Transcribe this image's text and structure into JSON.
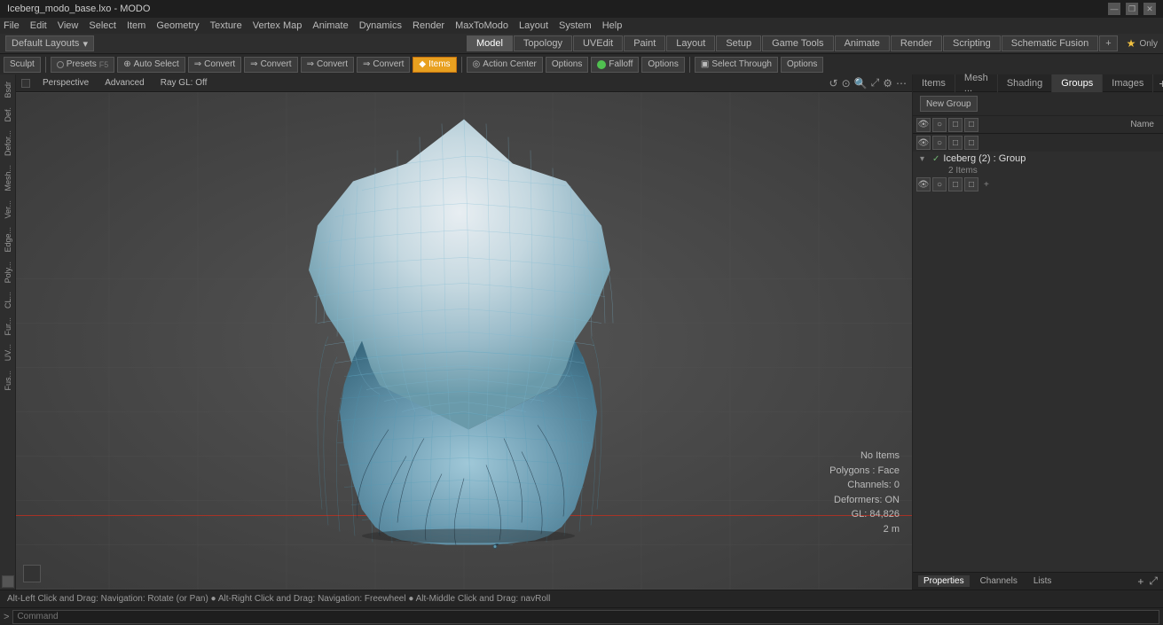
{
  "titleBar": {
    "title": "Iceberg_modo_base.lxo - MODO",
    "minimize": "—",
    "restore": "❐",
    "close": "✕"
  },
  "menuBar": {
    "items": [
      "File",
      "Edit",
      "View",
      "Select",
      "Item",
      "Geometry",
      "Texture",
      "Vertex Map",
      "Animate",
      "Dynamics",
      "Render",
      "MaxToModo",
      "Layout",
      "System",
      "Help"
    ]
  },
  "layoutsBar": {
    "dropdown": "Default Layouts",
    "tabs": [
      "Model",
      "Topology",
      "UVEdit",
      "Paint",
      "Layout",
      "Setup",
      "Game Tools",
      "Animate",
      "Render",
      "Scripting",
      "Schematic Fusion"
    ],
    "activeTab": "Model",
    "addButton": "+",
    "starLabel": "★ Only"
  },
  "toolbar": {
    "sculpt": "Sculpt",
    "presetsLabel": "Presets",
    "presetsShortcut": "F5",
    "autoSelect": "Auto Select",
    "convert1": "Convert",
    "convert2": "Convert",
    "convert3": "Convert",
    "convert4": "Convert",
    "items": "Items",
    "actionCenter": "Action Center",
    "options1": "Options",
    "falloff": "Falloff",
    "options2": "Options",
    "selectThrough": "Select Through",
    "options3": "Options"
  },
  "viewport": {
    "perspective": "Perspective",
    "advanced": "Advanced",
    "rayGL": "Ray GL: Off",
    "infoNoItems": "No Items",
    "infoPolygons": "Polygons : Face",
    "infoChannels": "Channels: 0",
    "infoDeformers": "Deformers: ON",
    "infoGL": "GL: 84,826",
    "infoDistance": "2 m"
  },
  "statusBar": {
    "text": "Alt-Left Click and Drag: Navigation: Rotate (or Pan)   ●  Alt-Right Click and Drag: Navigation: Freewheel   ●  Alt-Middle Click and Drag: navRoll"
  },
  "commandBar": {
    "prompt": ">",
    "inputPlaceholder": "Command",
    "inputValue": ""
  },
  "rightPanel": {
    "tabs": [
      "Items",
      "Mesh ...",
      "Shading",
      "Groups",
      "Images"
    ],
    "activeTab": "Groups",
    "newGroupLabel": "New Group",
    "toolbar": {
      "icons": [
        "eye",
        "render",
        "lock",
        "settings"
      ]
    },
    "nameHeader": "Name",
    "tree": {
      "group": {
        "label": "Iceberg (2) : Group",
        "expanded": true,
        "subLabel": "2 Items"
      }
    }
  },
  "bottomPanel": {
    "tabs": [
      "Properties",
      "Channels",
      "Lists"
    ],
    "activeTab": "Properties",
    "addButton": "+",
    "expandButton": "⤢"
  },
  "leftSidebar": {
    "tabs": [
      "Bsdr",
      "Def.",
      "Defor...",
      "Mesh...",
      "Ver...",
      "Edge...",
      "Poly...",
      "CL...",
      "Fur...",
      "UV...",
      "Fus..."
    ]
  },
  "colors": {
    "accent": "#e8a020",
    "activeTab": "#3a5a8a",
    "background": "#4a4a4a",
    "panelBg": "#2e2e2e",
    "icebergBlue": "#7ab8d0"
  }
}
